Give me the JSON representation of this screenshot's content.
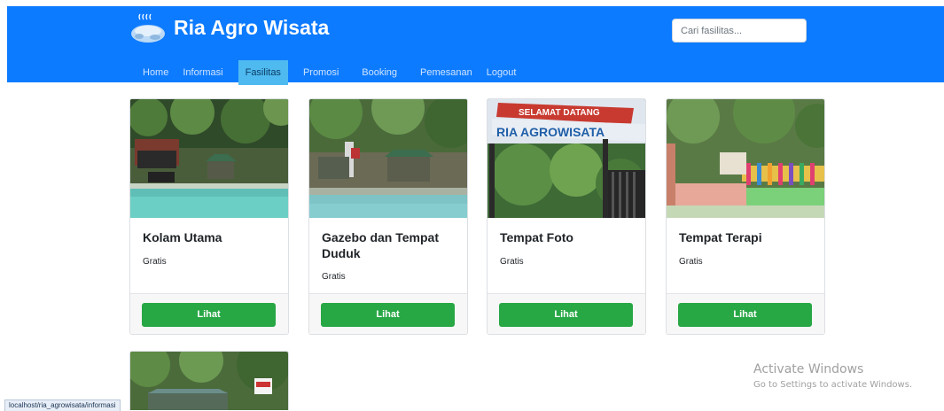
{
  "header": {
    "brand": "Ria Agro Wisata",
    "logo_icon": "hot-spring-icon",
    "search_placeholder": "Cari fasilitas...",
    "background": "#0d7bff"
  },
  "nav": {
    "items": [
      {
        "label": "Home",
        "active": false
      },
      {
        "label": "Informasi",
        "active": false
      },
      {
        "label": "Fasilitas",
        "active": true
      },
      {
        "label": "Promosi",
        "active": false
      },
      {
        "label": "Booking",
        "active": false
      },
      {
        "label": "Pemesanan",
        "active": false
      },
      {
        "label": "Logout",
        "active": false
      }
    ]
  },
  "cards": [
    {
      "title": "Kolam Utama",
      "price": "Gratis",
      "button": "Lihat"
    },
    {
      "title": "Gazebo dan Tempat Duduk",
      "price": "Gratis",
      "button": "Lihat"
    },
    {
      "title": "Tempat Foto",
      "price": "Gratis",
      "button": "Lihat",
      "photo_sign_top": "SELAMAT DATANG",
      "photo_sign_main": "RIA AGROWISATA"
    },
    {
      "title": "Tempat Terapi",
      "price": "Gratis",
      "button": "Lihat"
    }
  ],
  "colors": {
    "button": "#28a745",
    "nav_active": "#4fbaf0"
  },
  "watermark": {
    "line1": "Activate Windows",
    "line2": "Go to Settings to activate Windows."
  },
  "statusbar": {
    "url": "localhost/ria_agrowisata/informasi"
  }
}
